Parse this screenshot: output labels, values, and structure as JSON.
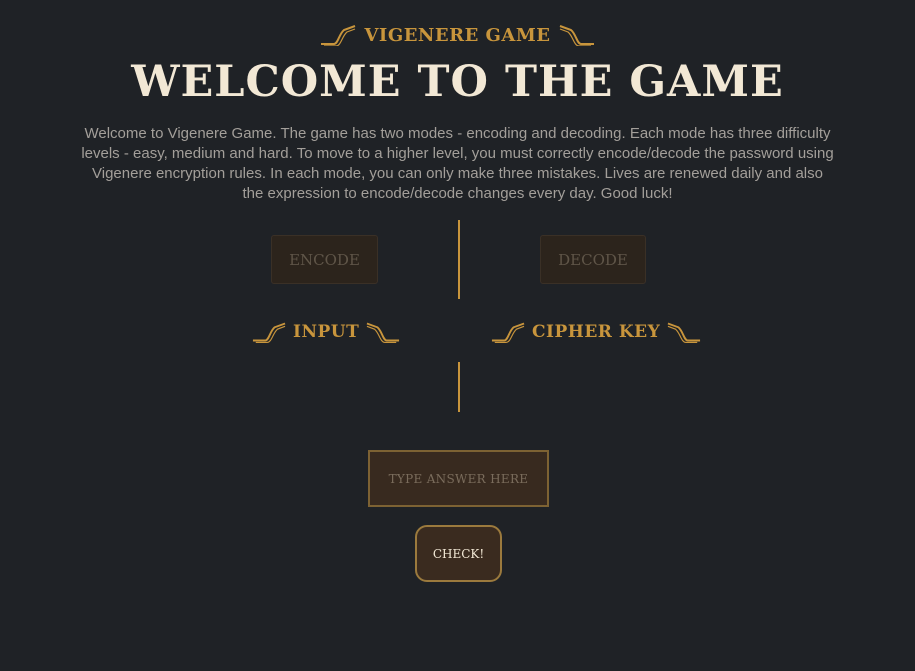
{
  "header": {
    "kicker": "VIGENERE GAME",
    "title": "WELCOME TO THE GAME",
    "description": "Welcome to Vigenere Game. The game has two modes - encoding and decoding. Each mode has three difficulty levels - easy, medium and hard. To move to a higher level, you must correctly encode/decode the password using Vigenere encryption rules. In each mode, you can only make three mistakes. Lives are renewed daily and also the expression to encode/decode changes every day. Good luck!"
  },
  "modes": {
    "encode_label": "ENCODE",
    "decode_label": "DECODE"
  },
  "sections": {
    "input_label": "INPUT",
    "cipher_key_label": "CIPHER KEY"
  },
  "answer": {
    "placeholder": "TYPE ANSWER HERE",
    "value": ""
  },
  "check_label": "CHECK!",
  "colors": {
    "background": "#1f2226",
    "accent_gold": "#c8953c",
    "title_cream": "#f2e8d5",
    "body_text": "#a39f9a",
    "button_brown": "#2c241c"
  },
  "icons": {
    "left_ornament": "left-swoosh-ornament-icon",
    "right_ornament": "right-swoosh-ornament-icon"
  }
}
